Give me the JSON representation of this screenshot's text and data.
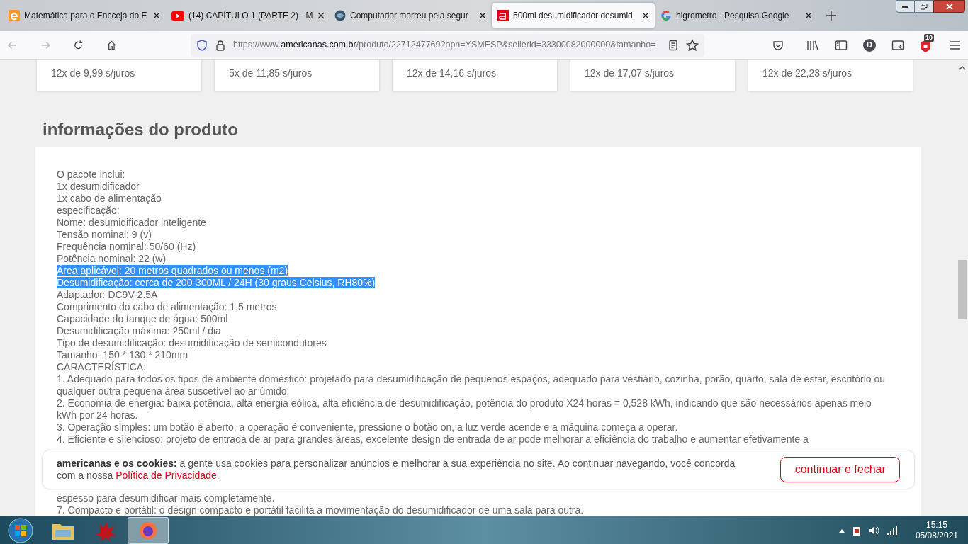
{
  "tabs": [
    {
      "title": "Matemática para o Encceja do E",
      "selected": false
    },
    {
      "title": "(14) CAPÍTULO 1 (PARTE 2) - M",
      "selected": false
    },
    {
      "title": "Computador morreu pela segur",
      "selected": false
    },
    {
      "title": "500ml desumidificador desumid",
      "selected": true
    },
    {
      "title": "higrometro - Pesquisa Google",
      "selected": false
    }
  ],
  "address_bar": {
    "host_prefix": "https://www.",
    "host": "americanas.com.br",
    "path": "/produto/2271247769?opn=YSMESP&sellerid=33300082000000&tamanho="
  },
  "toolbar": {
    "account_initial": "D",
    "shield_badge": "10"
  },
  "installments": [
    "12x de 9,99 s/juros",
    "5x de 11,85 s/juros",
    "12x de 14,16 s/juros",
    "12x de 17,07 s/juros",
    "12x de 22,23 s/juros"
  ],
  "section_title": "informações do produto",
  "description_lines": [
    {
      "text": "O pacote inclui:",
      "selected": false
    },
    {
      "text": "1x desumidificador",
      "selected": false
    },
    {
      "text": "1x cabo de alimentação",
      "selected": false
    },
    {
      "text": "especificação:",
      "selected": false
    },
    {
      "text": "Nome: desumidificador inteligente",
      "selected": false
    },
    {
      "text": "Tensão nominal: 9 (v)",
      "selected": false
    },
    {
      "text": "Frequência nominal: 50/60 (Hz)",
      "selected": false
    },
    {
      "text": "Potência nominal: 22 (w)",
      "selected": false
    },
    {
      "text": "Área aplicável: 20 metros quadrados ou menos (m2)",
      "selected": true
    },
    {
      "text": "Desumidificação: cerca de 200-300ML / 24H (30 graus Celsius, RH80%)",
      "selected": true
    },
    {
      "text": "Adaptador: DC9V-2.5A",
      "selected": false
    },
    {
      "text": "Comprimento do cabo de alimentação: 1,5 metros",
      "selected": false
    },
    {
      "text": "Capacidade do tanque de água: 500ml",
      "selected": false
    },
    {
      "text": "Desumidificação máxima: 250ml / dia",
      "selected": false
    },
    {
      "text": "Tipo de desumidificação: desumidificação de semicondutores",
      "selected": false
    },
    {
      "text": "Tamanho: 150 * 130 * 210mm",
      "selected": false
    },
    {
      "text": "CARACTERÍSTICA:",
      "selected": false
    },
    {
      "text": "1. Adequado para todos os tipos de ambiente doméstico: projetado para desumidificação de pequenos espaços, adequado para vestiário, cozinha, porão, quarto, sala de estar, escritório ou qualquer outra pequena área suscetível ao ar úmido.",
      "selected": false
    },
    {
      "text": "2. Economia de energia: baixa potência, alta energia eólica, alta eficiência de desumidificação, potência do produto X24 horas = 0,528 kWh, indicando que são necessários apenas meio kWh por 24 horas.",
      "selected": false
    },
    {
      "text": "3. Operação simples: um botão é aberto, a operação é conveniente, pressione o botão on, a luz verde acende e a máquina começa a operar.",
      "selected": false
    },
    {
      "text": "4. Eficiente e silencioso: projeto de entrada de ar para grandes áreas, excelente design de entrada de ar pode melhorar a eficiência do trabalho e aumentar efetivamente a",
      "selected": false
    }
  ],
  "description_tail": [
    "espesso para desumidificar mais completamente.",
    "7. Compacto e portátil: o design compacto e portátil facilita a movimentação do desumidificador de uma sala para outra."
  ],
  "cookie_banner": {
    "text": "**americanas e os cookies:** a gente usa cookies para personalizar anúncios e melhorar a sua experiência no site. Ao continuar navegando, você concorda com a nossa",
    "link": "Política de Privacidade",
    "end": ".",
    "button": "continuar e fechar"
  },
  "taskbar": {
    "time": "15:15",
    "date": "05/08/2021"
  }
}
